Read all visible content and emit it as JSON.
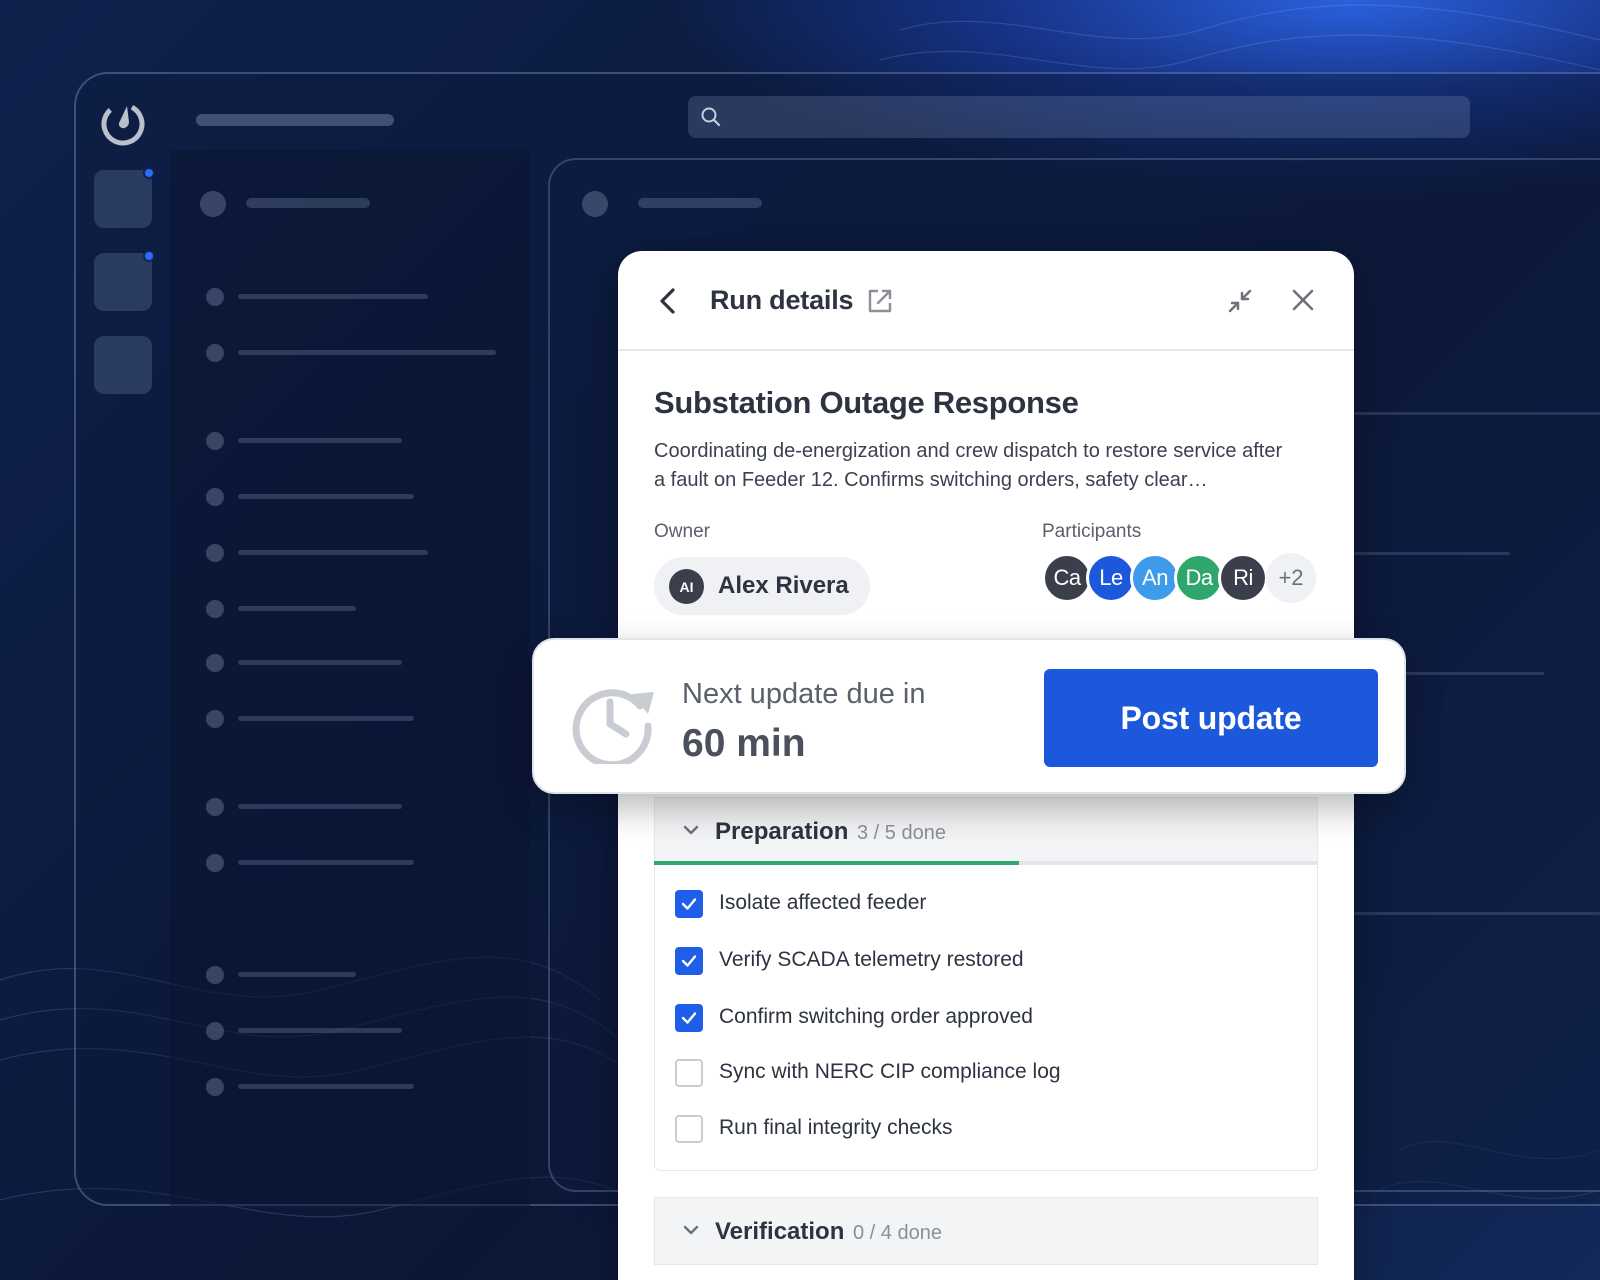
{
  "header": {
    "title": "Run details"
  },
  "run": {
    "name": "Substation Outage Response",
    "description": "Coordinating de-energization and crew dispatch to restore service after a fault on Feeder 12. Confirms switching orders, safety clear…"
  },
  "owner": {
    "label": "Owner",
    "initials": "AI",
    "name": "Alex Rivera"
  },
  "participants": {
    "label": "Participants",
    "avatars": [
      {
        "initials": "Ca",
        "color": "#3a3f4b"
      },
      {
        "initials": "Le",
        "color": "#1c58dc"
      },
      {
        "initials": "An",
        "color": "#3d9be9"
      },
      {
        "initials": "Da",
        "color": "#2fa66b"
      },
      {
        "initials": "Ri",
        "color": "#3a3f4b"
      }
    ],
    "more": "+2"
  },
  "update": {
    "label": "Next update due in",
    "value": "60 min",
    "button": "Post update"
  },
  "sections": [
    {
      "title": "Preparation",
      "done": "3",
      "total": "5",
      "done_suffix": "done",
      "progress": 0.55,
      "items": [
        {
          "label": "Isolate affected feeder",
          "checked": true
        },
        {
          "label": "Verify SCADA telemetry restored",
          "checked": true
        },
        {
          "label": "Confirm switching order approved",
          "checked": true
        },
        {
          "label": "Sync with NERC CIP compliance log",
          "checked": false
        },
        {
          "label": "Run final integrity checks",
          "checked": false
        }
      ]
    },
    {
      "title": "Verification",
      "done": "0",
      "total": "4",
      "done_suffix": "done"
    }
  ],
  "colors": {
    "accent": "#1c58dc",
    "progress": "#2fa66b"
  }
}
